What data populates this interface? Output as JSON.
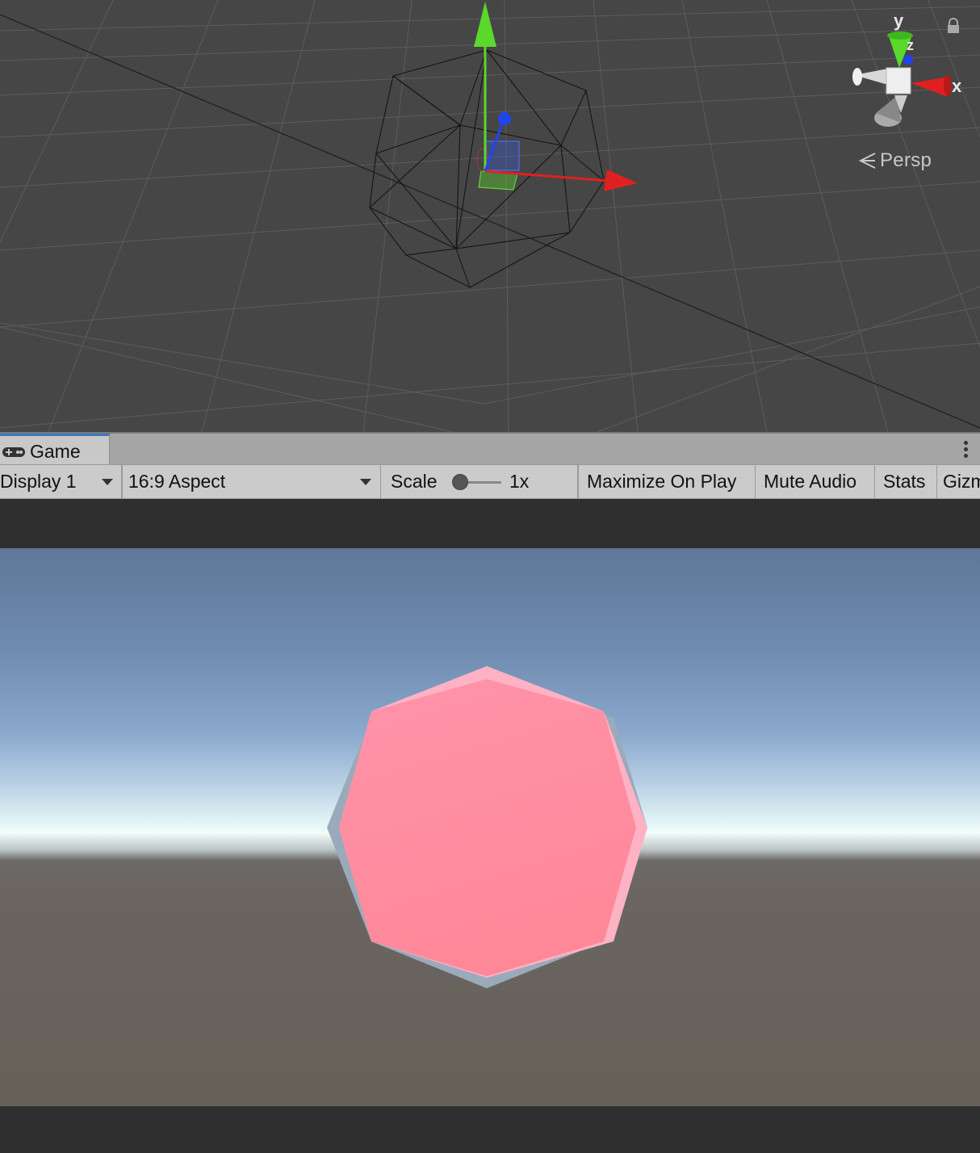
{
  "scene": {
    "camera_mode": "Persp",
    "gizmo_axes": {
      "x": "x",
      "y": "y",
      "z": "z"
    },
    "icons": [
      "lock-icon",
      "perspective-arrow-icon",
      "orientation-gizmo-icon",
      "move-gizmo-icon",
      "sphere-wireframe-icon"
    ]
  },
  "game_tab": {
    "label": "Game",
    "icon": "gamepad-icon"
  },
  "toolbar": {
    "display": "Display 1",
    "aspect": "16:9 Aspect",
    "scale_label": "Scale",
    "scale_value": "1x",
    "maximize": "Maximize On Play",
    "mute": "Mute Audio",
    "stats": "Stats",
    "gizmos": "Gizm"
  },
  "colors": {
    "x_axis": "#e02020",
    "y_axis": "#5bd82c",
    "z_axis": "#2244ee",
    "sphere": "#ff8ea3",
    "tab_accent": "#3a79bb"
  }
}
